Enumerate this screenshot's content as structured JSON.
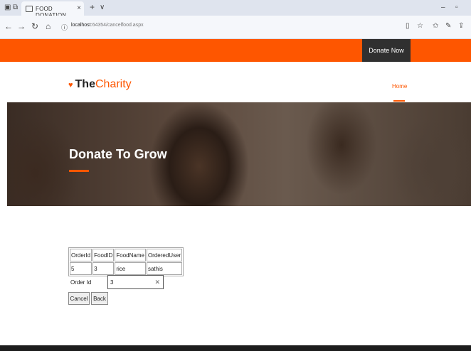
{
  "browser": {
    "tab_title": "FOOD DONATION",
    "tab_close": "×",
    "new_tab": "+",
    "tab_menu": "∨",
    "url_host": "localhost",
    "url_path": ":64354/cancelfood.aspx",
    "window_minimize": "–",
    "window_restore": "▫"
  },
  "topbar": {
    "donate_label": "Donate Now"
  },
  "header": {
    "logo_the": "The",
    "logo_charity": "Charity",
    "home_label": "Home"
  },
  "hero": {
    "title": "Donate To Grow"
  },
  "orders_table": {
    "headers": [
      "OrderId",
      "FoodID",
      "FoodName",
      "OrderedUser"
    ],
    "rows": [
      [
        "5",
        "3",
        "rice",
        "sathis"
      ]
    ]
  },
  "form": {
    "order_id_label": "Order Id",
    "order_id_value": "3",
    "cancel_label": "Cancel",
    "back_label": "Back"
  },
  "colors": {
    "accent": "#fe5600",
    "donate_bg": "#303030"
  }
}
